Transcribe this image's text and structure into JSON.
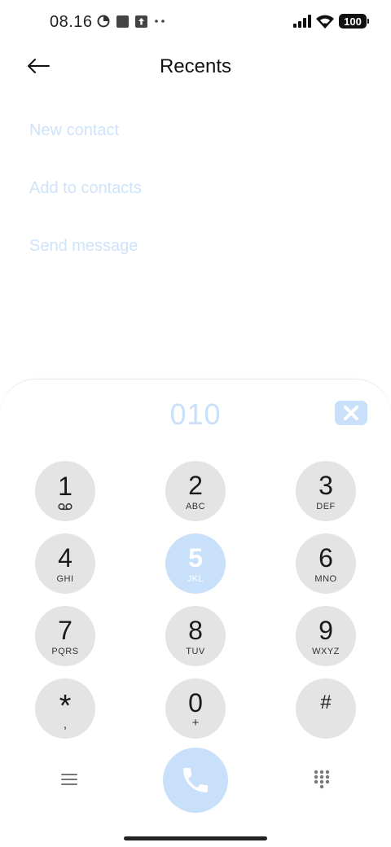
{
  "status_bar": {
    "time": "08.16",
    "battery": "100",
    "icons_left": [
      "data-saver-icon",
      "square-notification-icon",
      "upload-icon",
      "more-dots-icon"
    ],
    "icons_right": [
      "signal-icon",
      "wifi-icon",
      "battery-icon"
    ]
  },
  "header": {
    "title": "Recents",
    "back_icon": "arrow-left-icon"
  },
  "options": [
    {
      "label": "New contact"
    },
    {
      "label": "Add to contacts"
    },
    {
      "label": "Send message"
    }
  ],
  "dialpad": {
    "number": "010",
    "keys": [
      {
        "digit": "1",
        "sub": "voicemail-icon"
      },
      {
        "digit": "2",
        "letters": "ABC"
      },
      {
        "digit": "3",
        "letters": "DEF"
      },
      {
        "digit": "4",
        "letters": "GHI"
      },
      {
        "digit": "5",
        "letters": "JKL",
        "active": true
      },
      {
        "digit": "6",
        "letters": "MNO"
      },
      {
        "digit": "7",
        "letters": "PQRS"
      },
      {
        "digit": "8",
        "letters": "TUV"
      },
      {
        "digit": "9",
        "letters": "WXYZ"
      },
      {
        "digit": "*",
        "letters": ","
      },
      {
        "digit": "0",
        "letters": "+"
      },
      {
        "digit": "#",
        "letters": ""
      }
    ]
  },
  "colors": {
    "accent_light": "#c9e0fa",
    "option_text": "#cfe3fb",
    "key_bg": "#e4e4e4",
    "icon_gray": "#777777"
  }
}
